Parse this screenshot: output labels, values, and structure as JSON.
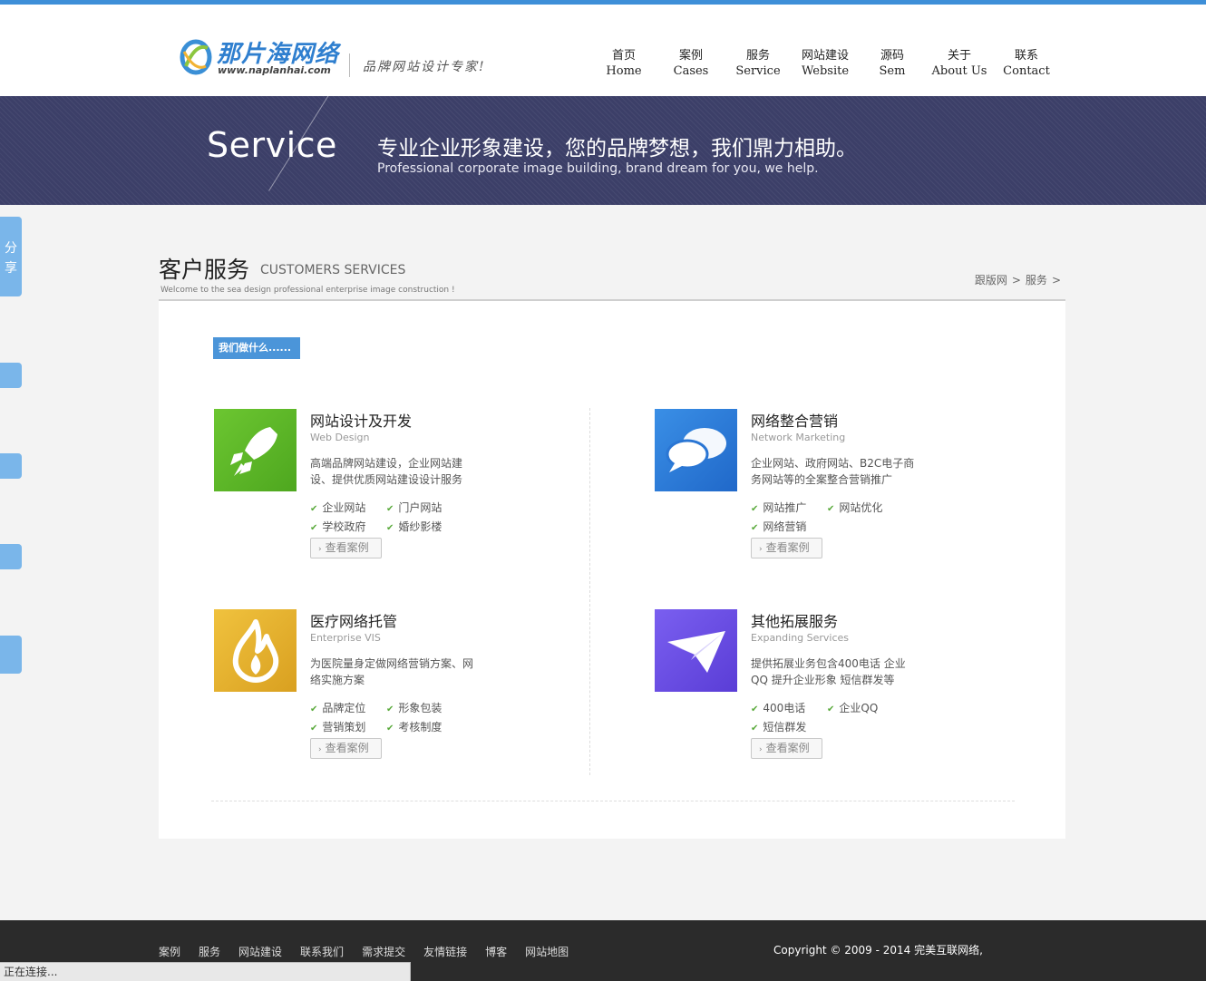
{
  "header": {
    "logo_name": "那片海网络",
    "logo_url": "www.naplanhai.com",
    "logo_slogan": "品牌网站设计专家!",
    "nav": [
      {
        "cn": "首页",
        "en": "Home"
      },
      {
        "cn": "案例",
        "en": "Cases"
      },
      {
        "cn": "服务",
        "en": "Service"
      },
      {
        "cn": "网站建设",
        "en": "Website"
      },
      {
        "cn": "源码",
        "en": "Sem"
      },
      {
        "cn": "关于",
        "en": "About Us"
      },
      {
        "cn": "联系",
        "en": "Contact"
      }
    ]
  },
  "banner": {
    "title": "Service",
    "cn": "专业企业形象建设，您的品牌梦想，我们鼎力相助。",
    "en": "Professional corporate image building, brand dream for you, we help."
  },
  "sidebar": {
    "share_1": "分",
    "share_2": "享"
  },
  "section": {
    "title_cn": "客户服务",
    "title_en": "CUSTOMERS SERVICES",
    "subtitle": "Welcome to the sea design professional enterprise image construction !",
    "breadcrumb": [
      "跟版网",
      "服务"
    ],
    "gt": ">"
  },
  "panel": {
    "what_we_do": "我们做什么......",
    "view_cases_label": "查看案例",
    "services": [
      {
        "title": "网站设计及开发",
        "en": "Web Design",
        "desc": "高端品牌网站建设，企业网站建设、提供优质网站建设设计服务",
        "tags": [
          "企业网站",
          "门户网站",
          "学校政府",
          "婚纱影楼"
        ],
        "icon": "rocket-icon",
        "color": "#5cb82b"
      },
      {
        "title": "网络整合营销",
        "en": "Network Marketing",
        "desc": "企业网站、政府网站、B2C电子商务网站等的全案整合营销推广",
        "tags": [
          "网站推广",
          "网站优化",
          "网络营销"
        ],
        "icon": "chat-bubbles-icon",
        "color": "#2f7fd9"
      },
      {
        "title": "医疗网络托管",
        "en": "Enterprise VIS",
        "desc": "为医院量身定做网络营销方案、网络实施方案",
        "tags": [
          "品牌定位",
          "形象包装",
          "营销策划",
          "考核制度"
        ],
        "icon": "flame-icon",
        "color": "#e6b42a"
      },
      {
        "title": "其他拓展服务",
        "en": "Expanding Services",
        "desc": "提供拓展业务包含400电话 企业QQ 提升企业形象 短信群发等",
        "tags": [
          "400电话",
          "企业QQ",
          "短信群发"
        ],
        "icon": "paper-plane-icon",
        "color": "#6a4fe0"
      }
    ]
  },
  "footer": {
    "links": [
      "案例",
      "服务",
      "网站建设",
      "联系我们",
      "需求提交",
      "友情链接",
      "博客",
      "网站地图"
    ],
    "copyright": "Copyright © 2009 - 2014 完美互联网络,"
  },
  "status_bar": "正在连接..."
}
